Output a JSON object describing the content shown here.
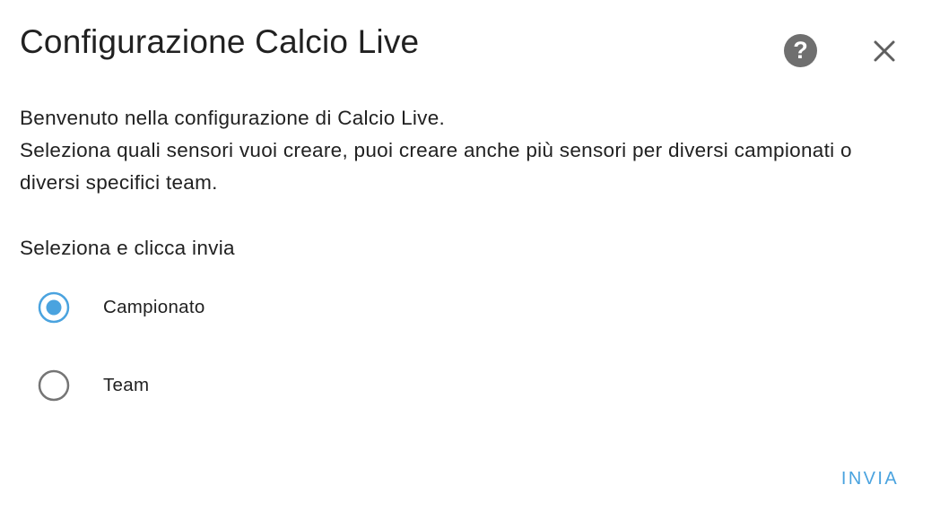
{
  "dialog": {
    "title": "Configurazione Calcio Live",
    "help_icon": "help-circle-icon",
    "close_icon": "close-icon"
  },
  "description": {
    "line1": "Benvenuto nella configurazione di Calcio Live.",
    "line2": "Seleziona quali sensori vuoi creare, puoi creare anche più sensori per diversi campionati o diversi specifici team."
  },
  "form": {
    "label": "Seleziona e clicca invia",
    "options": [
      {
        "label": "Campionato",
        "selected": true
      },
      {
        "label": "Team",
        "selected": false
      }
    ]
  },
  "actions": {
    "submit_label": "INVIA"
  },
  "colors": {
    "accent": "#4aa3df",
    "radio_unselected": "#757575",
    "help_icon_bg": "#6f6f6f"
  }
}
